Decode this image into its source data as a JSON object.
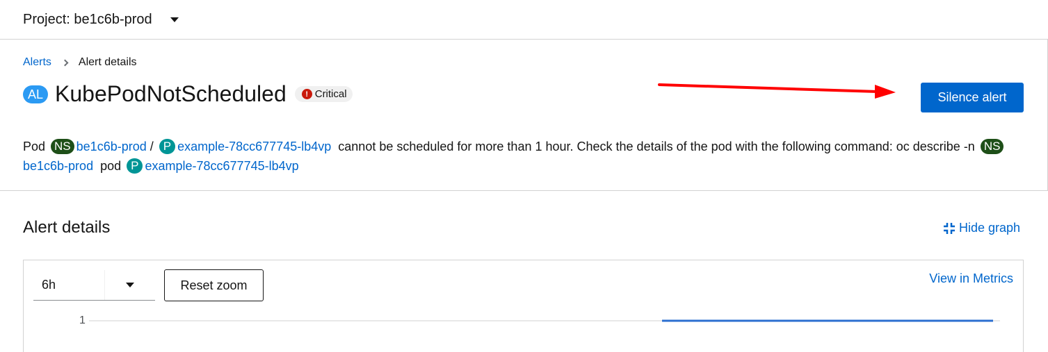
{
  "project": {
    "label": "Project: be1c6b-prod"
  },
  "breadcrumb": {
    "parent": "Alerts",
    "current": "Alert details"
  },
  "alert": {
    "badge": "AL",
    "name": "KubePodNotScheduled",
    "severity": "Critical",
    "severity_icon": "!",
    "silence_label": "Silence alert"
  },
  "description": {
    "prefix": "Pod",
    "ns_badge": "NS",
    "namespace": "be1c6b-prod",
    "sep": "/",
    "pod_badge": "P",
    "pod": "example-78cc677745-lb4vp",
    "middle": "cannot be scheduled for more than 1 hour. Check the details of the pod with the following command: oc describe -n",
    "pod_word": "pod"
  },
  "details": {
    "title": "Alert details",
    "hide_graph": "Hide graph",
    "time_range": "6h",
    "reset_zoom": "Reset zoom",
    "view_metrics": "View in Metrics",
    "y_tick": "1"
  },
  "colors": {
    "link": "#0066cc",
    "critical": "#c9190b",
    "namespace_badge": "#1e4f18",
    "pod_badge": "#009596",
    "alert_badge": "#2b9af3",
    "annotation_arrow": "#ff0000"
  },
  "chart_data": {
    "type": "line",
    "series": [
      {
        "values": [
          1,
          1
        ]
      }
    ],
    "ylim": [
      0,
      1
    ],
    "xlabel": "",
    "ylabel": ""
  }
}
